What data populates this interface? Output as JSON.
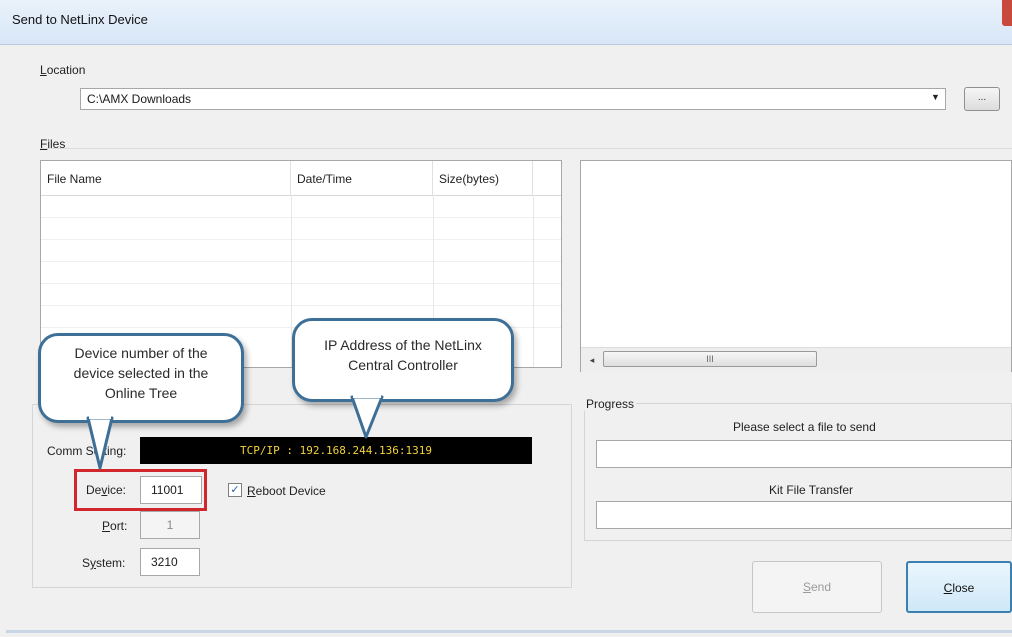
{
  "window": {
    "title": "Send to NetLinx Device"
  },
  "location": {
    "label_underlined": "L",
    "label_rest": "ocation",
    "value": "C:\\AMX Downloads",
    "browse_label": "..."
  },
  "files": {
    "label_underlined": "F",
    "label_rest": "iles",
    "columns": [
      "File Name",
      "Date/Time",
      "Size(bytes)"
    ],
    "rows": []
  },
  "hscroll": {
    "left_arrow": "◂",
    "thumb_grip": "III"
  },
  "comm": {
    "label": "Comm Setting:",
    "value": "TCP/IP : 192.168.244.136:1319"
  },
  "device": {
    "label_pre": "De",
    "label_underlined": "v",
    "label_post": "ice:",
    "value": "11001",
    "reboot_underlined": "R",
    "reboot_rest": "eboot Device",
    "reboot_checked": true,
    "check_glyph": "✓"
  },
  "port": {
    "label_underlined": "P",
    "label_rest": "ort:",
    "value": "1"
  },
  "system": {
    "label_pre": "S",
    "label_underlined": "y",
    "label_post": "stem:",
    "value": "3210"
  },
  "progress": {
    "label": "Progress",
    "status1": "Please select a file to send",
    "status2": "Kit File Transfer",
    "value1": 0,
    "value2": 0
  },
  "buttons": {
    "send_underlined": "S",
    "send_rest": "end",
    "close_underlined": "C",
    "close_rest": "lose"
  },
  "callouts": {
    "device_note": [
      "Device number of the",
      "device selected in the",
      "Online Tree"
    ],
    "ip_note": [
      "IP Address of the NetLinx",
      "Central Controller"
    ]
  },
  "colors": {
    "highlight_border": "#d1262b",
    "comm_text": "#f2d23b",
    "callout_border": "#3e6f96"
  }
}
